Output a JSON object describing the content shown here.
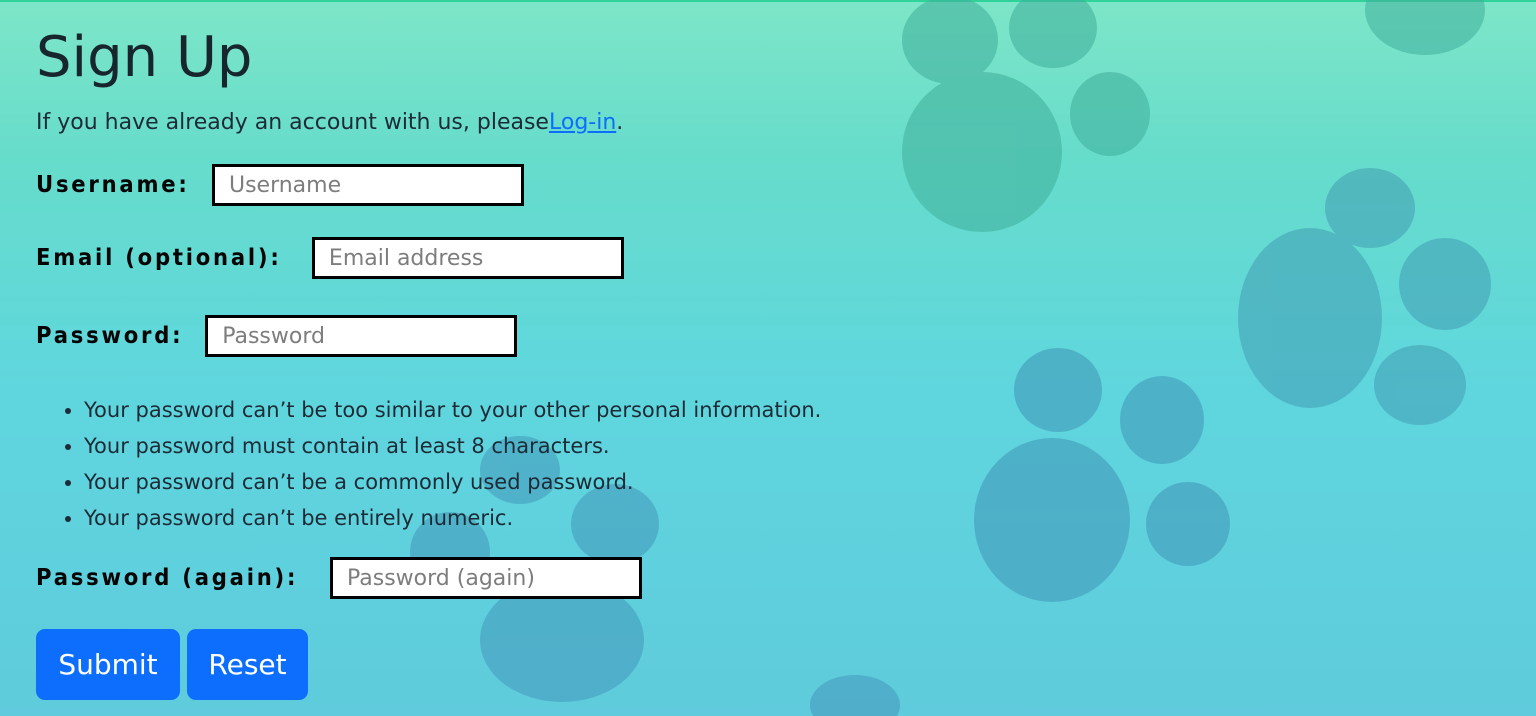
{
  "page": {
    "title": "Sign Up",
    "intro_text": "If you have already an account with us, please",
    "login_link": "Log-in",
    "intro_suffix": "."
  },
  "form": {
    "username": {
      "label": "Username:",
      "placeholder": "Username",
      "value": ""
    },
    "email": {
      "label": "Email (optional):",
      "placeholder": "Email address",
      "value": ""
    },
    "password": {
      "label": "Password:",
      "placeholder": "Password",
      "value": ""
    },
    "password_rules": [
      "Your password can’t be too similar to your other personal information.",
      "Your password must contain at least 8 characters.",
      "Your password can’t be a commonly used password.",
      "Your password can’t be entirely numeric."
    ],
    "password_again": {
      "label": "Password (again):",
      "placeholder": "Password (again)",
      "value": ""
    },
    "submit_label": "Submit",
    "reset_label": "Reset"
  },
  "colors": {
    "accent": "#0d6efd",
    "background_top": "#7ee6c8",
    "background_bottom": "#5fcbdc",
    "paw_print": "#3fa8a8"
  },
  "icons": [
    "paw-print-icon"
  ]
}
